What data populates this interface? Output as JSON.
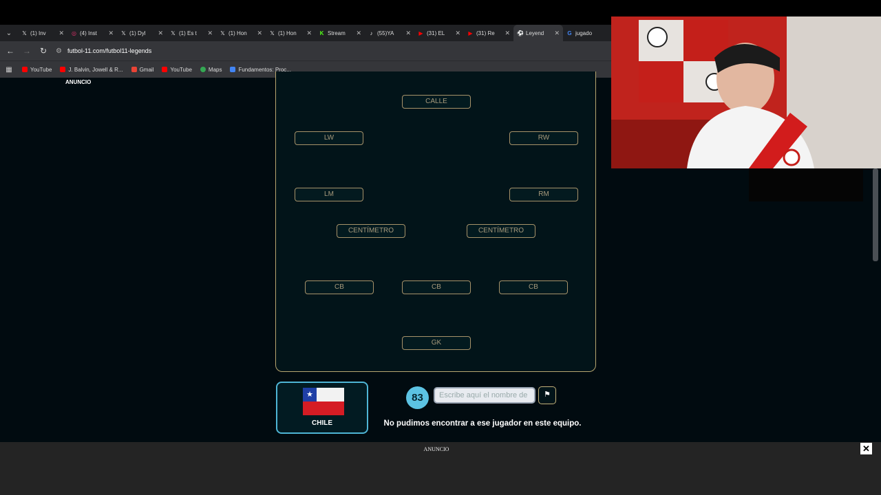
{
  "browser": {
    "tabs": [
      {
        "label": "(1) Inv",
        "icon": "x-icon"
      },
      {
        "label": "(4) Inst",
        "icon": "instagram-icon"
      },
      {
        "label": "(1) Dyl",
        "icon": "x-icon"
      },
      {
        "label": "(1) Es t",
        "icon": "x-icon"
      },
      {
        "label": "(1) Hon",
        "icon": "x-icon"
      },
      {
        "label": "(1) Hon",
        "icon": "x-icon"
      },
      {
        "label": "Stream",
        "icon": "kick-icon"
      },
      {
        "label": "(55)YA",
        "icon": "tiktok-icon"
      },
      {
        "label": "(31) EL",
        "icon": "youtube-icon"
      },
      {
        "label": "(31) Re",
        "icon": "youtube-icon"
      },
      {
        "label": "Leyend",
        "icon": "futbol11-icon",
        "active": true
      },
      {
        "label": "jugado",
        "icon": "google-icon"
      }
    ],
    "url": "futbol-11.com/futbol11-legends",
    "bookmarks": [
      {
        "label": "YouTube",
        "color": "#ff0000"
      },
      {
        "label": "J. Balvin, Jowell & R...",
        "color": "#ff0000"
      },
      {
        "label": "Gmail",
        "color": "#ea4335"
      },
      {
        "label": "YouTube",
        "color": "#ff0000"
      },
      {
        "label": "Maps",
        "color": "#34a853"
      },
      {
        "label": "Fundamentos: Proc...",
        "color": "#4285f4"
      }
    ]
  },
  "page": {
    "ad_top_label": "ANUNCIO",
    "positions": {
      "st": "CALLE",
      "lw": "LW",
      "rw": "RW",
      "lm": "LM",
      "rm": "RM",
      "cm_left": "CENTÍMETRO",
      "cm_right": "CENTÍMETRO",
      "cb_left": "CB",
      "cb_center": "CB",
      "cb_right": "CB",
      "gk": "GK"
    },
    "team": {
      "name": "CHILE"
    },
    "score": "83",
    "search_placeholder": "Escribe aquí el nombre de",
    "message": "No pudimos encontrar a ese jugador en este equipo.",
    "ad_bottom_label": "ANUNCIO",
    "ad_close": "✕"
  }
}
